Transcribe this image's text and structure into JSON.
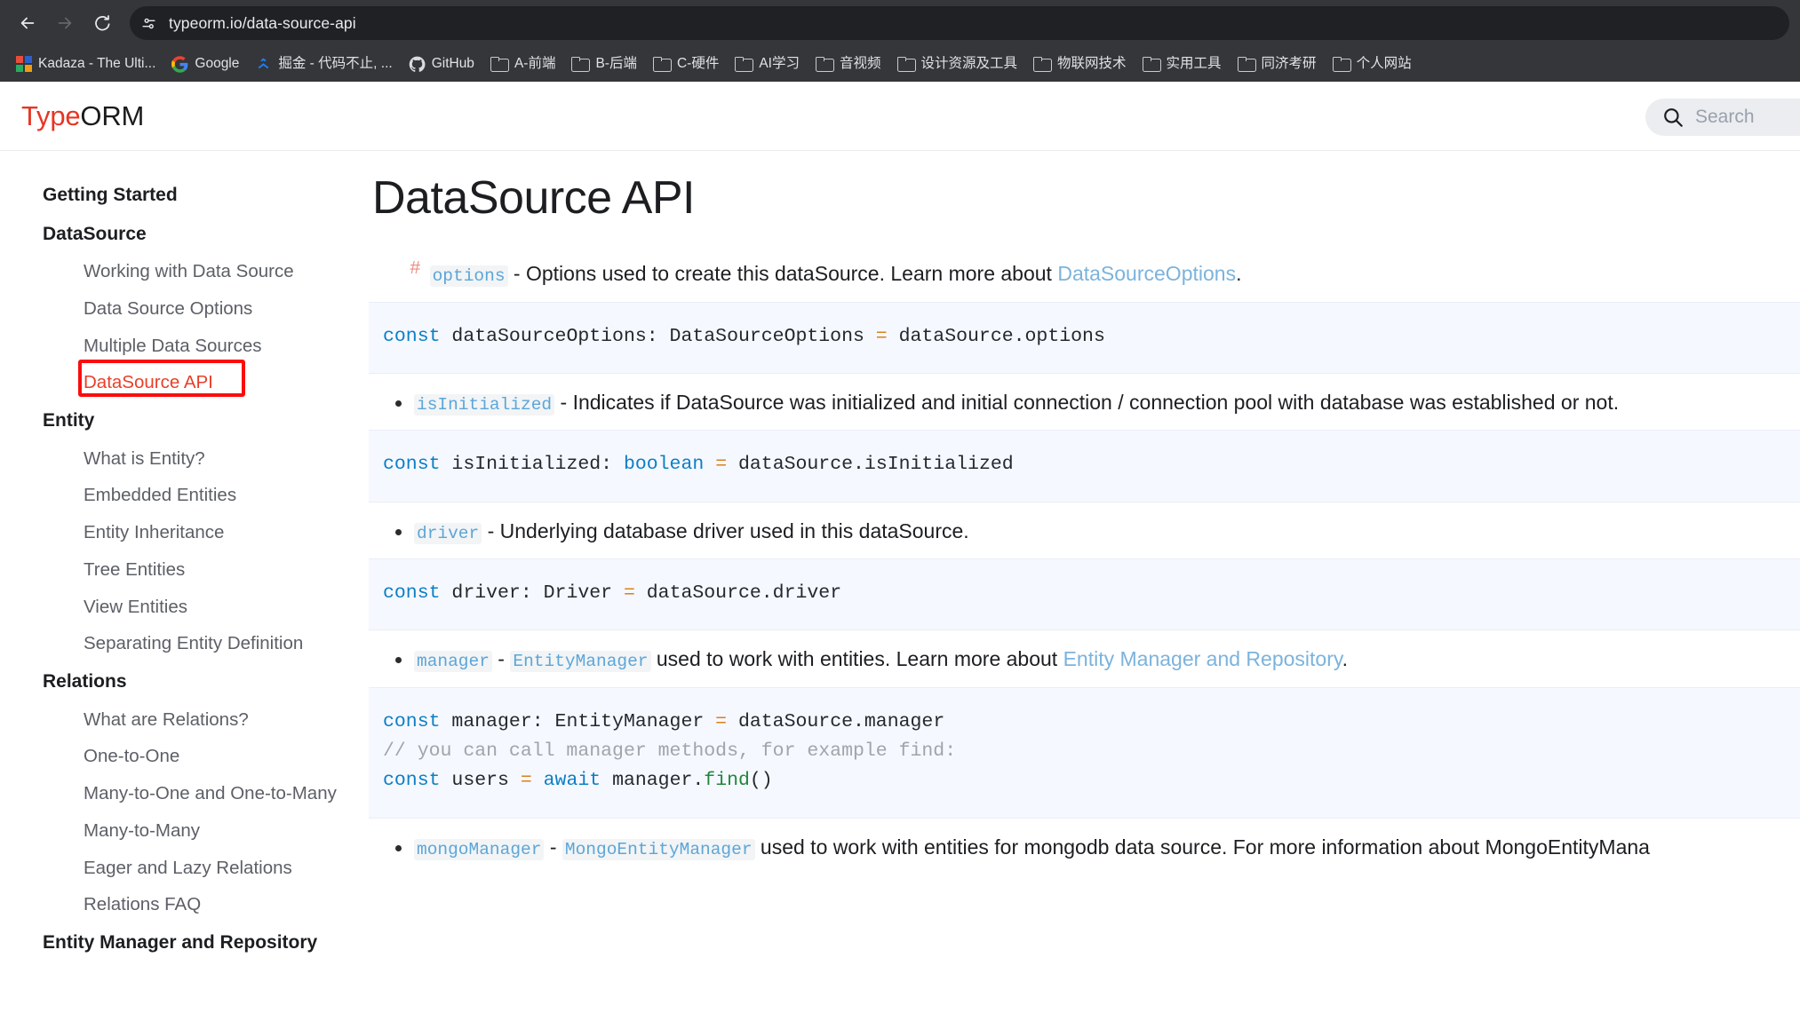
{
  "browser": {
    "url": "typeorm.io/data-source-api",
    "nav": {
      "back_label": "Back",
      "forward_label": "Forward",
      "reload_label": "Reload",
      "site_info_label": "View site information"
    },
    "bookmarks": [
      {
        "label": "Kadaza - The Ulti...",
        "icon": "kadaza-icon"
      },
      {
        "label": "Google",
        "icon": "google-icon"
      },
      {
        "label": "掘金 - 代码不止, ...",
        "icon": "juejin-icon"
      },
      {
        "label": "GitHub",
        "icon": "github-icon"
      },
      {
        "label": "A-前端",
        "icon": "folder-icon"
      },
      {
        "label": "B-后端",
        "icon": "folder-icon"
      },
      {
        "label": "C-硬件",
        "icon": "folder-icon"
      },
      {
        "label": "AI学习",
        "icon": "folder-icon"
      },
      {
        "label": "音视频",
        "icon": "folder-icon"
      },
      {
        "label": "设计资源及工具",
        "icon": "folder-icon"
      },
      {
        "label": "物联网技术",
        "icon": "folder-icon"
      },
      {
        "label": "实用工具",
        "icon": "folder-icon"
      },
      {
        "label": "同济考研",
        "icon": "folder-icon"
      },
      {
        "label": "个人网站",
        "icon": "folder-icon"
      }
    ]
  },
  "site": {
    "brand_primary": "Type",
    "brand_secondary": "ORM",
    "brand_color": "#e83524",
    "search": {
      "placeholder": "Search",
      "icon": "search-icon"
    }
  },
  "sidebar": {
    "groups": [
      {
        "category": "Getting Started",
        "links": []
      },
      {
        "category": "DataSource",
        "links": [
          {
            "label": "Working with Data Source",
            "active": false
          },
          {
            "label": "Data Source Options",
            "active": false
          },
          {
            "label": "Multiple Data Sources",
            "active": false
          },
          {
            "label": "DataSource API",
            "active": true
          }
        ]
      },
      {
        "category": "Entity",
        "links": [
          {
            "label": "What is Entity?",
            "active": false
          },
          {
            "label": "Embedded Entities",
            "active": false
          },
          {
            "label": "Entity Inheritance",
            "active": false
          },
          {
            "label": "Tree Entities",
            "active": false
          },
          {
            "label": "View Entities",
            "active": false
          },
          {
            "label": "Separating Entity Definition",
            "active": false
          }
        ]
      },
      {
        "category": "Relations",
        "links": [
          {
            "label": "What are Relations?",
            "active": false
          },
          {
            "label": "One-to-One",
            "active": false
          },
          {
            "label": "Many-to-One and One-to-Many",
            "active": false
          },
          {
            "label": "Many-to-Many",
            "active": false
          },
          {
            "label": "Eager and Lazy Relations",
            "active": false
          },
          {
            "label": "Relations FAQ",
            "active": false
          }
        ]
      },
      {
        "category": "Entity Manager and Repository",
        "links": []
      }
    ],
    "highlight_color": "#fb0d0d",
    "highlighted_item": "DataSource API"
  },
  "main": {
    "title": "DataSource API",
    "items": [
      {
        "anchor": "#",
        "code": "options",
        "text_after": " - Options used to create this dataSource. Learn more about ",
        "link": "DataSourceOptions",
        "text_end": ".",
        "codeblock": [
          {
            "tokens": [
              {
                "t": "const",
                "c": "kw"
              },
              {
                "t": " dataSourceOptions",
                "c": ""
              },
              {
                "t": ":",
                "c": ""
              },
              {
                "t": " DataSourceOptions ",
                "c": "typ"
              },
              {
                "t": "=",
                "c": "op"
              },
              {
                "t": " dataSource.options",
                "c": ""
              }
            ]
          }
        ]
      },
      {
        "anchor": "",
        "code": "isInitialized",
        "text_after": " - Indicates if DataSource was initialized and initial connection / connection pool with database was established or not.",
        "link": "",
        "text_end": "",
        "codeblock": [
          {
            "tokens": [
              {
                "t": "const",
                "c": "kw"
              },
              {
                "t": " isInitialized",
                "c": ""
              },
              {
                "t": ": ",
                "c": ""
              },
              {
                "t": "boolean",
                "c": "kw"
              },
              {
                "t": " ",
                "c": ""
              },
              {
                "t": "=",
                "c": "op"
              },
              {
                "t": " dataSource.isInitialized",
                "c": ""
              }
            ]
          }
        ]
      },
      {
        "anchor": "",
        "code": "driver",
        "text_after": " - Underlying database driver used in this dataSource.",
        "link": "",
        "text_end": "",
        "codeblock": [
          {
            "tokens": [
              {
                "t": "const",
                "c": "kw"
              },
              {
                "t": " driver",
                "c": ""
              },
              {
                "t": ": Driver ",
                "c": ""
              },
              {
                "t": "=",
                "c": "op"
              },
              {
                "t": " dataSource.driver",
                "c": ""
              }
            ]
          }
        ]
      },
      {
        "anchor": "",
        "code": "manager",
        "code2": "EntityManager",
        "text_after": " used to work with entities. Learn more about ",
        "link": "Entity Manager and Repository",
        "text_end": ".",
        "codeblock": [
          {
            "tokens": [
              {
                "t": "const",
                "c": "kw"
              },
              {
                "t": " manager",
                "c": ""
              },
              {
                "t": ": EntityManager ",
                "c": ""
              },
              {
                "t": "=",
                "c": "op"
              },
              {
                "t": " dataSource.manager",
                "c": ""
              }
            ]
          },
          {
            "tokens": [
              {
                "t": "// you can call manager methods, for example find:",
                "c": "cmt"
              }
            ]
          },
          {
            "tokens": [
              {
                "t": "const",
                "c": "kw"
              },
              {
                "t": " users ",
                "c": ""
              },
              {
                "t": "=",
                "c": "op"
              },
              {
                "t": " ",
                "c": ""
              },
              {
                "t": "await",
                "c": "kw"
              },
              {
                "t": " manager.",
                "c": ""
              },
              {
                "t": "find",
                "c": "fn"
              },
              {
                "t": "()",
                "c": ""
              }
            ]
          }
        ]
      },
      {
        "anchor": "",
        "code": "mongoManager",
        "code2": "MongoEntityManager",
        "text_after": " used to work with entities for mongodb data source. For more information about MongoEntityMana",
        "link": "",
        "text_end": "",
        "codeblock": []
      }
    ]
  }
}
